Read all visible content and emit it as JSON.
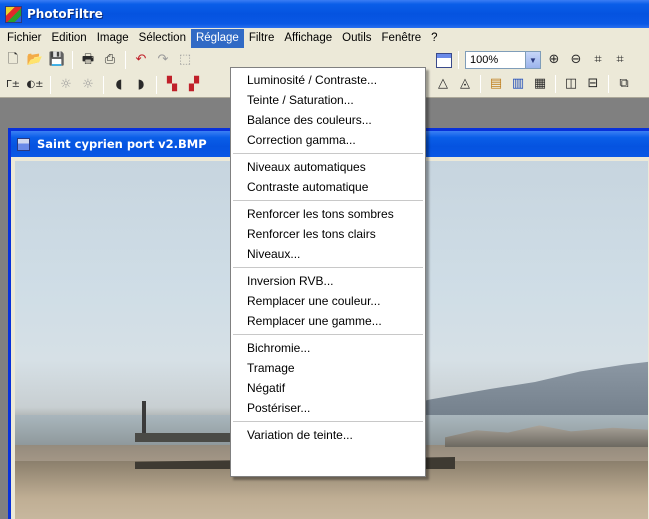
{
  "window": {
    "title": "PhotoFiltre"
  },
  "menubar": {
    "items": [
      {
        "label": "Fichier"
      },
      {
        "label": "Edition"
      },
      {
        "label": "Image"
      },
      {
        "label": "Sélection"
      },
      {
        "label": "Réglage",
        "active": true
      },
      {
        "label": "Filtre"
      },
      {
        "label": "Affichage"
      },
      {
        "label": "Outils"
      },
      {
        "label": "Fenêtre"
      },
      {
        "label": "?"
      }
    ]
  },
  "toolbar": {
    "zoom_value": "100%"
  },
  "document": {
    "title": "Saint cyprien port v2.BMP"
  },
  "reglage_menu": {
    "groups": [
      [
        "Luminosité / Contraste...",
        "Teinte / Saturation...",
        "Balance des couleurs...",
        "Correction gamma..."
      ],
      [
        "Niveaux automatiques",
        "Contraste automatique"
      ],
      [
        "Renforcer les tons sombres",
        "Renforcer les tons clairs",
        "Niveaux..."
      ],
      [
        "Inversion RVB...",
        "Remplacer une couleur...",
        "Remplacer une gamme..."
      ],
      [
        "Bichromie...",
        "Tramage",
        "Négatif",
        "Postériser..."
      ],
      [
        "Variation de teinte..."
      ]
    ]
  },
  "colors": {
    "title_blue": "#0553e0",
    "menu_highlight": "#316ac5",
    "face": "#ece9d8"
  }
}
